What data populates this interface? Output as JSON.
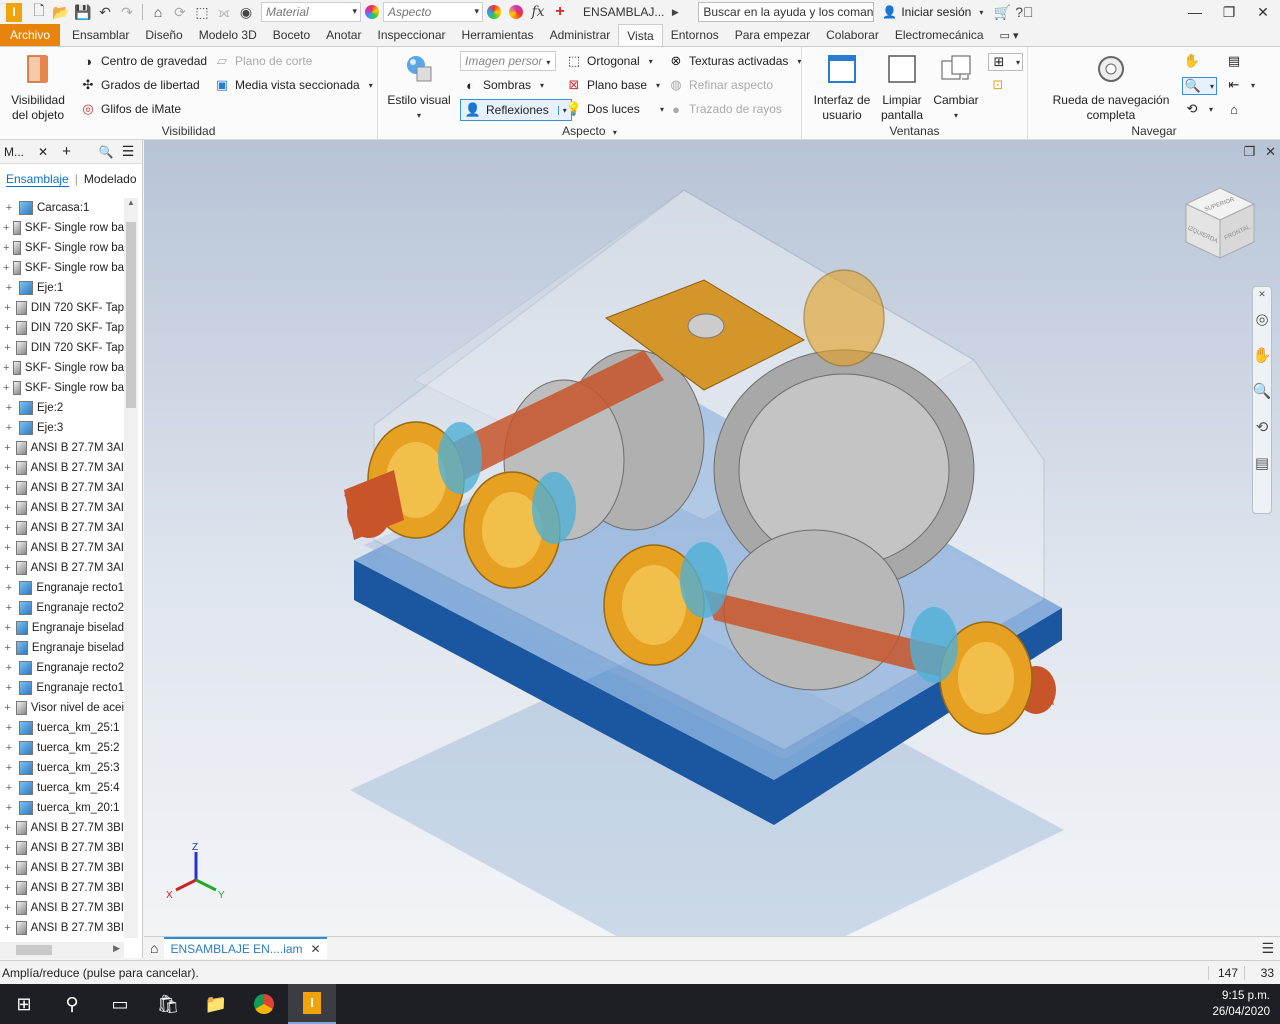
{
  "titlebar": {
    "material_placeholder": "Material",
    "appearance_placeholder": "Aspecto",
    "doc_title": "ENSAMBLAJ...",
    "search": "Buscar en la ayuda y los comanc",
    "signin": "Iniciar sesión"
  },
  "tabs": [
    "Archivo",
    "Ensamblar",
    "Diseño",
    "Modelo 3D",
    "Boceto",
    "Anotar",
    "Inspeccionar",
    "Herramientas",
    "Administrar",
    "Vista",
    "Entornos",
    "Para empezar",
    "Colaborar",
    "Electromecánica"
  ],
  "ribbon": {
    "visibility": {
      "object_visibility": "Visibilidad del objeto",
      "center_gravity": "Centro de gravedad",
      "dof": "Grados de libertad",
      "imate": "Glifos de iMate",
      "cut_plane": "Plano de corte",
      "half_section": "Media vista seccionada",
      "title": "Visibilidad"
    },
    "appearance": {
      "visual_style": "Estilo visual",
      "image_combo": "Imagen persor",
      "orthographic": "Ortogonal",
      "textures": "Texturas activadas",
      "shadows": "Sombras",
      "ground_plane": "Plano base",
      "refine": "Refinar aspecto",
      "reflections": "Reflexiones",
      "two_lights": "Dos luces",
      "ray_tracing": "Trazado de rayos",
      "title": "Aspecto"
    },
    "windows": {
      "ui": "Interfaz de usuario",
      "clean": "Limpiar pantalla",
      "switch": "Cambiar",
      "title": "Ventanas"
    },
    "navigate": {
      "wheel": "Rueda de navegación completa",
      "title": "Navegar"
    }
  },
  "browser": {
    "header": "M...",
    "tab_assembly": "Ensamblaje",
    "tab_modeling": "Modelado",
    "items": [
      {
        "label": "Carcasa:1",
        "type": "part"
      },
      {
        "label": "SKF- Single row ba",
        "type": "asm"
      },
      {
        "label": "SKF- Single row ba",
        "type": "asm"
      },
      {
        "label": "SKF- Single row ba",
        "type": "asm"
      },
      {
        "label": "Eje:1",
        "type": "part"
      },
      {
        "label": "DIN 720 SKF- Tap",
        "type": "asm"
      },
      {
        "label": "DIN 720 SKF- Tap",
        "type": "asm"
      },
      {
        "label": "DIN 720 SKF- Tap",
        "type": "asm"
      },
      {
        "label": "SKF- Single row ba",
        "type": "asm"
      },
      {
        "label": "SKF- Single row ba",
        "type": "asm"
      },
      {
        "label": "Eje:2",
        "type": "part"
      },
      {
        "label": "Eje:3",
        "type": "part"
      },
      {
        "label": "ANSI B 27.7M 3AI",
        "type": "asm"
      },
      {
        "label": "ANSI B 27.7M 3AI",
        "type": "asm"
      },
      {
        "label": "ANSI B 27.7M 3AI",
        "type": "asm"
      },
      {
        "label": "ANSI B 27.7M 3AI",
        "type": "asm"
      },
      {
        "label": "ANSI B 27.7M 3AI",
        "type": "asm"
      },
      {
        "label": "ANSI B 27.7M 3AI",
        "type": "asm"
      },
      {
        "label": "ANSI B 27.7M 3AI",
        "type": "asm"
      },
      {
        "label": "Engranaje recto1",
        "type": "part"
      },
      {
        "label": "Engranaje recto2",
        "type": "part"
      },
      {
        "label": "Engranaje biselad",
        "type": "part"
      },
      {
        "label": "Engranaje biselad",
        "type": "part"
      },
      {
        "label": "Engranaje recto2",
        "type": "part"
      },
      {
        "label": "Engranaje recto1",
        "type": "part"
      },
      {
        "label": "Visor nivel de acei",
        "type": "asm"
      },
      {
        "label": "tuerca_km_25:1",
        "type": "part"
      },
      {
        "label": "tuerca_km_25:2",
        "type": "part"
      },
      {
        "label": "tuerca_km_25:3",
        "type": "part"
      },
      {
        "label": "tuerca_km_25:4",
        "type": "part"
      },
      {
        "label": "tuerca_km_20:1",
        "type": "part"
      },
      {
        "label": "ANSI B 27.7M 3BI",
        "type": "asm"
      },
      {
        "label": "ANSI B 27.7M 3BI",
        "type": "asm"
      },
      {
        "label": "ANSI B 27.7M 3BI",
        "type": "asm"
      },
      {
        "label": "ANSI B 27.7M 3BI",
        "type": "asm"
      },
      {
        "label": "ANSI B 27.7M 3BI",
        "type": "asm"
      },
      {
        "label": "ANSI B 27.7M 3BI",
        "type": "asm"
      }
    ]
  },
  "viewcube": {
    "top": "SUPERIOR",
    "left": "IZQUIERDA",
    "front": "FRONTAL"
  },
  "axes": {
    "x": "X",
    "y": "Y",
    "z": "Z"
  },
  "doc_tab": "ENSAMBLAJE EN....iam",
  "status": {
    "message": "Amplía/reduce (pulse para cancelar).",
    "n1": "147",
    "n2": "33"
  },
  "clock": {
    "time": "9:15 p.m.",
    "date": "26/04/2020"
  },
  "colors": {
    "accent": "#e8840c",
    "casing": "#1e5fa8",
    "flange": "#e8a020",
    "shaft": "#c8552a",
    "gear": "#9a9a9a"
  }
}
